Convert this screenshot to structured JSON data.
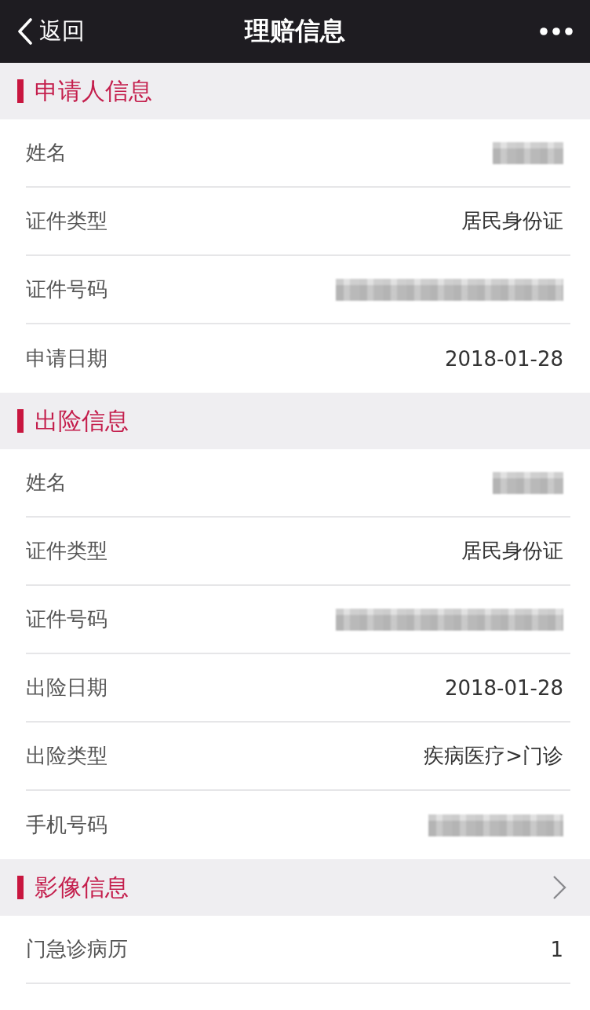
{
  "nav_bar": {
    "back": "返回",
    "title": "理赔信息"
  },
  "sections": [
    {
      "title": "申请人信息",
      "has_arrow": false,
      "rows": [
        {
          "label": "姓名",
          "kind": "shortblur"
        },
        {
          "label": "证件类型",
          "kind": "text",
          "value": "居民身份证"
        },
        {
          "label": "证件号码",
          "kind": "longblur"
        },
        {
          "label": "申请日期",
          "kind": "text",
          "value": "2018-01-28"
        }
      ]
    },
    {
      "title": "出险信息",
      "has_arrow": false,
      "rows": [
        {
          "label": "姓名",
          "kind": "shortblur"
        },
        {
          "label": "证件类型",
          "kind": "text",
          "value": "居民身份证"
        },
        {
          "label": "证件号码",
          "kind": "longblur"
        },
        {
          "label": "出险日期",
          "kind": "text",
          "value": "2018-01-28"
        },
        {
          "label": "出险类型",
          "kind": "text",
          "value": "疾病医疗>门诊"
        },
        {
          "label": "手机号码",
          "kind": "mediumblur"
        }
      ]
    },
    {
      "title": "影像信息",
      "has_arrow": true,
      "rows": [
        {
          "label": "门急诊病历",
          "kind": "text",
          "value": "1"
        }
      ]
    }
  ]
}
